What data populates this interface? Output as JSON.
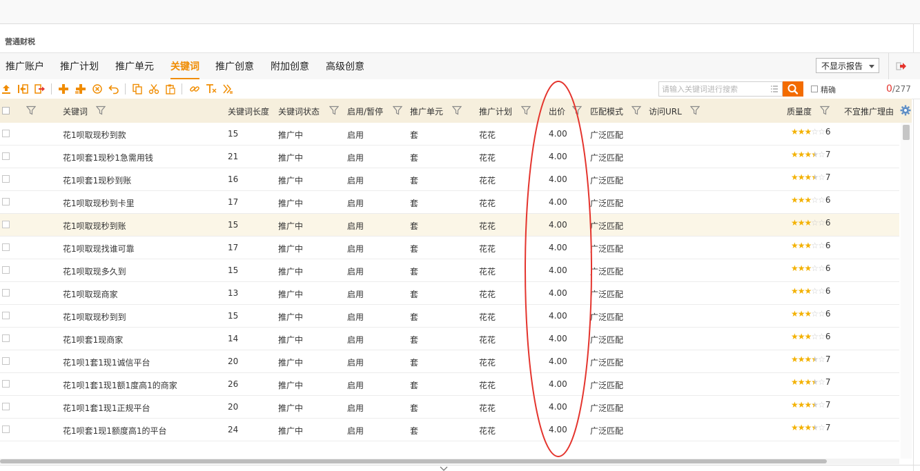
{
  "account": {
    "title": "营通财税"
  },
  "tabs": [
    {
      "label": "推广账户",
      "active": false
    },
    {
      "label": "推广计划",
      "active": false
    },
    {
      "label": "推广单元",
      "active": false
    },
    {
      "label": "关键词",
      "active": true
    },
    {
      "label": "推广创意",
      "active": false
    },
    {
      "label": "附加创意",
      "active": false
    },
    {
      "label": "高级创意",
      "active": false
    }
  ],
  "report_select": {
    "value": "不显示报告"
  },
  "search": {
    "placeholder": "请输入关键词进行搜索",
    "precise_label": "精确"
  },
  "counter": {
    "current": "0",
    "total": "/277"
  },
  "columns": {
    "keyword": "关键词",
    "length": "关键词长度",
    "status": "关键词状态",
    "enable": "启用/暂停",
    "unit": "推广单元",
    "plan": "推广计划",
    "bid": "出价",
    "match": "匹配模式",
    "url": "访问URL",
    "quality": "质量度",
    "reason": "不宜推广理由"
  },
  "rows": [
    {
      "keyword": "花1呗取现秒到款",
      "length": "15",
      "status": "推广中",
      "enable": "启用",
      "unit": "套",
      "plan": "花花",
      "bid": "4.00",
      "match": "广泛匹配",
      "quality": "6"
    },
    {
      "keyword": "花1呗套1现秒1急需用钱",
      "length": "21",
      "status": "推广中",
      "enable": "启用",
      "unit": "套",
      "plan": "花花",
      "bid": "4.00",
      "match": "广泛匹配",
      "quality": "7"
    },
    {
      "keyword": "花1呗套1现秒到账",
      "length": "16",
      "status": "推广中",
      "enable": "启用",
      "unit": "套",
      "plan": "花花",
      "bid": "4.00",
      "match": "广泛匹配",
      "quality": "7"
    },
    {
      "keyword": "花1呗取现秒到卡里",
      "length": "17",
      "status": "推广中",
      "enable": "启用",
      "unit": "套",
      "plan": "花花",
      "bid": "4.00",
      "match": "广泛匹配",
      "quality": "6"
    },
    {
      "keyword": "花1呗取现秒到账",
      "length": "15",
      "status": "推广中",
      "enable": "启用",
      "unit": "套",
      "plan": "花花",
      "bid": "4.00",
      "match": "广泛匹配",
      "quality": "6",
      "highlight": true
    },
    {
      "keyword": "花1呗取现找谁可靠",
      "length": "17",
      "status": "推广中",
      "enable": "启用",
      "unit": "套",
      "plan": "花花",
      "bid": "4.00",
      "match": "广泛匹配",
      "quality": "6"
    },
    {
      "keyword": "花1呗取现多久到",
      "length": "15",
      "status": "推广中",
      "enable": "启用",
      "unit": "套",
      "plan": "花花",
      "bid": "4.00",
      "match": "广泛匹配",
      "quality": "6"
    },
    {
      "keyword": "花1呗取现商家",
      "length": "13",
      "status": "推广中",
      "enable": "启用",
      "unit": "套",
      "plan": "花花",
      "bid": "4.00",
      "match": "广泛匹配",
      "quality": "6"
    },
    {
      "keyword": "花1呗取现秒到到",
      "length": "15",
      "status": "推广中",
      "enable": "启用",
      "unit": "套",
      "plan": "花花",
      "bid": "4.00",
      "match": "广泛匹配",
      "quality": "6"
    },
    {
      "keyword": "花1呗套1现商家",
      "length": "14",
      "status": "推广中",
      "enable": "启用",
      "unit": "套",
      "plan": "花花",
      "bid": "4.00",
      "match": "广泛匹配",
      "quality": "6"
    },
    {
      "keyword": "花1呗1套1现1诚信平台",
      "length": "20",
      "status": "推广中",
      "enable": "启用",
      "unit": "套",
      "plan": "花花",
      "bid": "4.00",
      "match": "广泛匹配",
      "quality": "7"
    },
    {
      "keyword": "花1呗1套1现1额1度高1的商家",
      "length": "26",
      "status": "推广中",
      "enable": "启用",
      "unit": "套",
      "plan": "花花",
      "bid": "4.00",
      "match": "广泛匹配",
      "quality": "7"
    },
    {
      "keyword": "花1呗1套1现1正规平台",
      "length": "20",
      "status": "推广中",
      "enable": "启用",
      "unit": "套",
      "plan": "花花",
      "bid": "4.00",
      "match": "广泛匹配",
      "quality": "7"
    },
    {
      "keyword": "花1呗套1现1额度高1的平台",
      "length": "24",
      "status": "推广中",
      "enable": "启用",
      "unit": "套",
      "plan": "花花",
      "bid": "4.00",
      "match": "广泛匹配",
      "quality": "7"
    }
  ],
  "icons": {
    "toolbar": [
      "upload-icon",
      "import-icon",
      "export-icon",
      "add-icon",
      "batch-add-icon",
      "delete-icon",
      "undo-icon",
      "copy-icon",
      "cut-icon",
      "paste-icon",
      "link-icon",
      "text-replace-icon",
      "format-icon"
    ],
    "filter": "filter-icon",
    "search": "search-icon",
    "settings": "gear-icon",
    "exit": "exit-icon"
  },
  "colors": {
    "accent": "#f08c00",
    "search_button": "#f36c00",
    "header_bg": "#f6efdd",
    "star": "#f3b100",
    "annotation": "#e4342d"
  }
}
